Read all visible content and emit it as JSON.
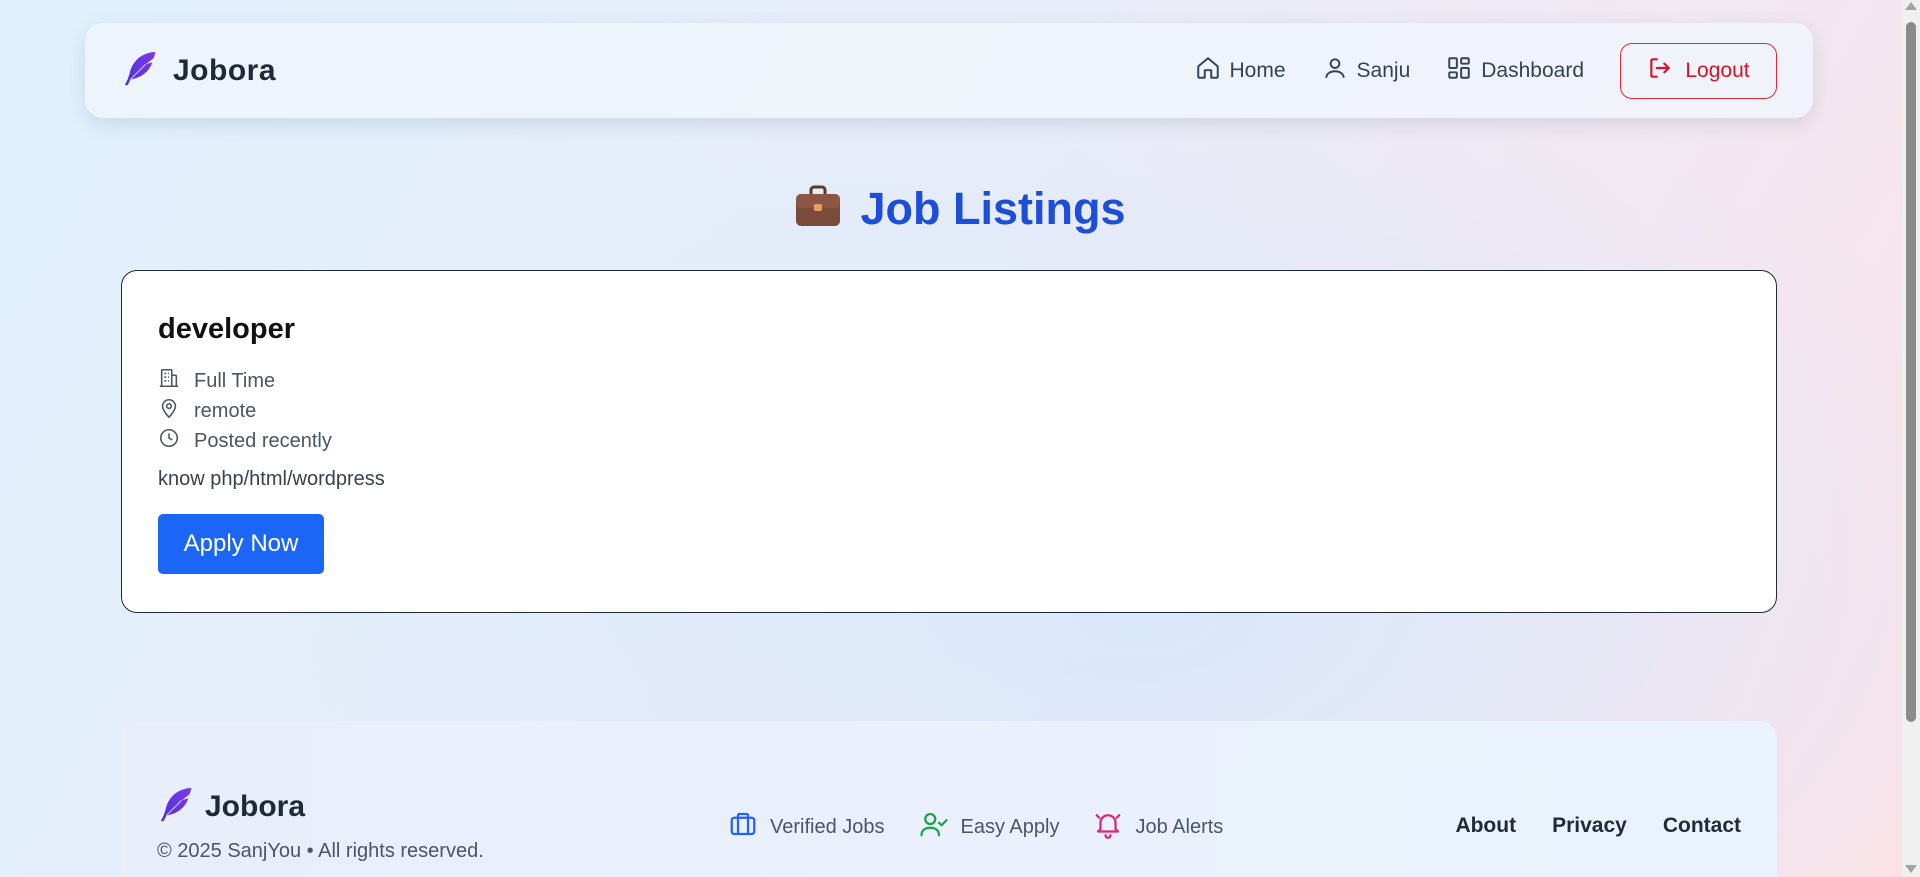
{
  "navbar": {
    "brand": "Jobora",
    "links": [
      {
        "label": "Home",
        "icon": "home-icon"
      },
      {
        "label": "Sanju",
        "icon": "user-icon"
      },
      {
        "label": "Dashboard",
        "icon": "dashboard-icon"
      }
    ],
    "logout_label": "Logout"
  },
  "page": {
    "heading": "Job Listings",
    "heading_emoji": "💼"
  },
  "job": {
    "title": "developer",
    "type": "Full Time",
    "location": "remote",
    "posted": "Posted recently",
    "description": "know php/html/wordpress",
    "apply_label": "Apply Now"
  },
  "footer": {
    "brand": "Jobora",
    "copyright": "© 2025 SanjYou • All rights reserved.",
    "features": [
      {
        "label": "Verified Jobs",
        "icon": "briefcase-icon",
        "color": "#2563eb"
      },
      {
        "label": "Easy Apply",
        "icon": "user-check-icon",
        "color": "#16a34a"
      },
      {
        "label": "Job Alerts",
        "icon": "bell-icon",
        "color": "#db2777"
      }
    ],
    "links": [
      "About",
      "Privacy",
      "Contact"
    ]
  },
  "colors": {
    "accent": "#1d4ed8",
    "button": "#1b66f5",
    "logout": "#d41428",
    "brand_icon": "#5b21e6"
  }
}
